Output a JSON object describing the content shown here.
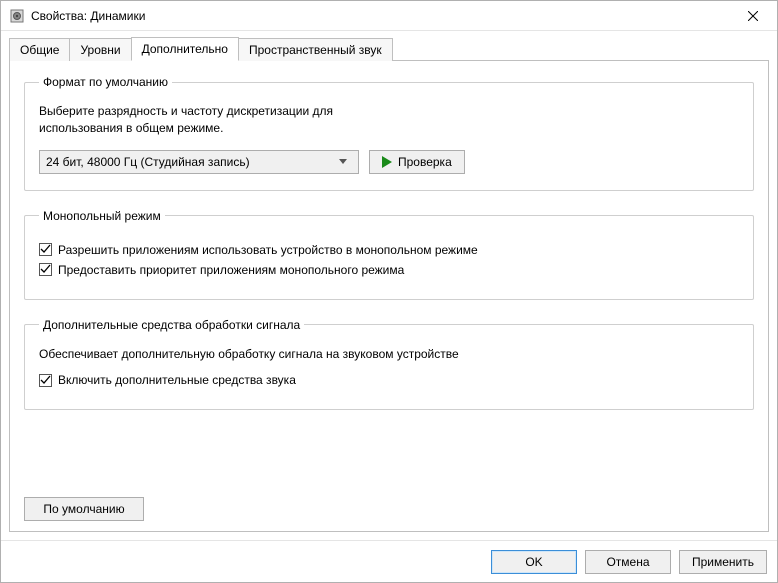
{
  "window": {
    "title": "Свойства: Динамики"
  },
  "tabs": [
    {
      "label": "Общие"
    },
    {
      "label": "Уровни"
    },
    {
      "label": "Дополнительно"
    },
    {
      "label": "Пространственный звук"
    }
  ],
  "default_format": {
    "legend": "Формат по умолчанию",
    "description": "Выберите разрядность и частоту дискретизации для использования в общем режиме.",
    "selected": "24 бит, 48000 Гц (Студийная запись)",
    "test_button": "Проверка"
  },
  "exclusive_mode": {
    "legend": "Монопольный режим",
    "allow": "Разрешить приложениям использовать устройство в монопольном режиме",
    "priority": "Предоставить приоритет приложениям монопольного режима"
  },
  "enhancements": {
    "legend": "Дополнительные средства обработки сигнала",
    "description": "Обеспечивает дополнительную обработку сигнала на звуковом устройстве",
    "enable": "Включить дополнительные средства звука"
  },
  "defaults_button": "По умолчанию",
  "footer": {
    "ok": "OK",
    "cancel": "Отмена",
    "apply": "Применить"
  }
}
